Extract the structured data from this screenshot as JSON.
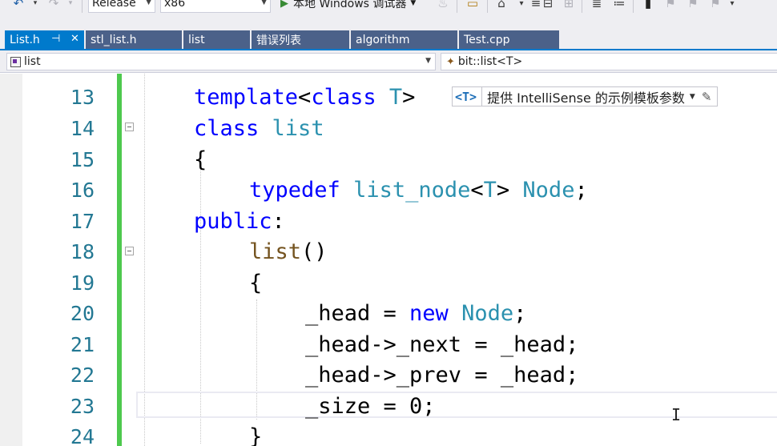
{
  "toolbar": {
    "config": "Release",
    "platform": "x86",
    "debug_target": "本地 Windows 调试器"
  },
  "tabs": [
    {
      "label": "List.h",
      "active": true
    },
    {
      "label": "stl_list.h",
      "active": false
    },
    {
      "label": "list",
      "active": false
    },
    {
      "label": "错误列表",
      "active": false
    },
    {
      "label": "algorithm",
      "active": false
    },
    {
      "label": "Test.cpp",
      "active": false
    }
  ],
  "navbar": {
    "scope": "list",
    "member": "bit::list<T>"
  },
  "hint": {
    "tag": "<T>",
    "text": "提供 IntelliSense 的示例模板参数"
  },
  "editor": {
    "lines": [
      {
        "num": "13",
        "code": "template<class T>"
      },
      {
        "num": "14",
        "code": "class list"
      },
      {
        "num": "15",
        "code": "{"
      },
      {
        "num": "16",
        "code": "typedef list_node<T> Node;"
      },
      {
        "num": "17",
        "code": "public:"
      },
      {
        "num": "18",
        "code": "list()"
      },
      {
        "num": "19",
        "code": "{"
      },
      {
        "num": "20",
        "code": "_head = new Node;"
      },
      {
        "num": "21",
        "code": "_head->_next = _head;"
      },
      {
        "num": "22",
        "code": "_head->_prev = _head;"
      },
      {
        "num": "23",
        "code": "_size = 0;"
      },
      {
        "num": "24",
        "code": "}"
      }
    ]
  },
  "colors": {
    "keyword": "#0000ff",
    "type": "#2b91af",
    "function": "#74531f",
    "line_number": "#237893",
    "change_bar": "#4ec94e",
    "active_tab": "#007acc",
    "inactive_tab": "#4b6189"
  },
  "icons": [
    "undo-icon",
    "redo-icon",
    "run-icon",
    "find-icon",
    "home-icon",
    "bookmark-icon",
    "comment-icon",
    "pencil-icon"
  ]
}
